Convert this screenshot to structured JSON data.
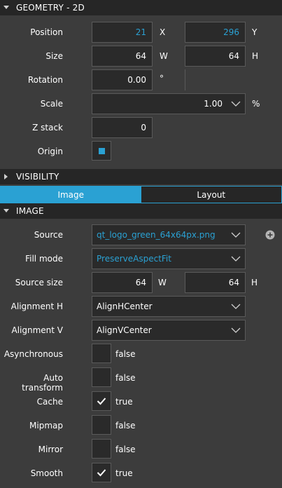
{
  "geometry": {
    "header": "GEOMETRY - 2D",
    "position": {
      "label": "Position",
      "x": "21",
      "x_unit": "X",
      "y": "296",
      "y_unit": "Y"
    },
    "size": {
      "label": "Size",
      "w": "64",
      "w_unit": "W",
      "h": "64",
      "h_unit": "H"
    },
    "rotation": {
      "label": "Rotation",
      "value": "0.00",
      "unit": "°"
    },
    "scale": {
      "label": "Scale",
      "value": "1.00",
      "unit": "%"
    },
    "zstack": {
      "label": "Z stack",
      "value": "0"
    },
    "origin": {
      "label": "Origin"
    }
  },
  "visibility": {
    "header": "VISIBILITY"
  },
  "tabs": [
    {
      "label": "Image",
      "active": true
    },
    {
      "label": "Layout",
      "active": false
    }
  ],
  "image": {
    "header": "IMAGE",
    "source": {
      "label": "Source",
      "value": "qt_logo_green_64x64px.png"
    },
    "fill_mode": {
      "label": "Fill mode",
      "value": "PreserveAspectFit"
    },
    "source_size": {
      "label": "Source size",
      "w": "64",
      "w_unit": "W",
      "h": "64",
      "h_unit": "H"
    },
    "align_h": {
      "label": "Alignment H",
      "value": "AlignHCenter"
    },
    "align_v": {
      "label": "Alignment V",
      "value": "AlignVCenter"
    },
    "asynchronous": {
      "label": "Asynchronous",
      "value": "false",
      "checked": false
    },
    "auto_transform": {
      "label": "Auto transform",
      "value": "false",
      "checked": false
    },
    "cache": {
      "label": "Cache",
      "value": "true",
      "checked": true
    },
    "mipmap": {
      "label": "Mipmap",
      "value": "false",
      "checked": false
    },
    "mirror": {
      "label": "Mirror",
      "value": "false",
      "checked": false
    },
    "smooth": {
      "label": "Smooth",
      "value": "true",
      "checked": true
    }
  },
  "colors": {
    "accent": "#2aa1d3",
    "panel": "#3c3c3c",
    "header": "#262626",
    "field": "#2a2a2a"
  }
}
